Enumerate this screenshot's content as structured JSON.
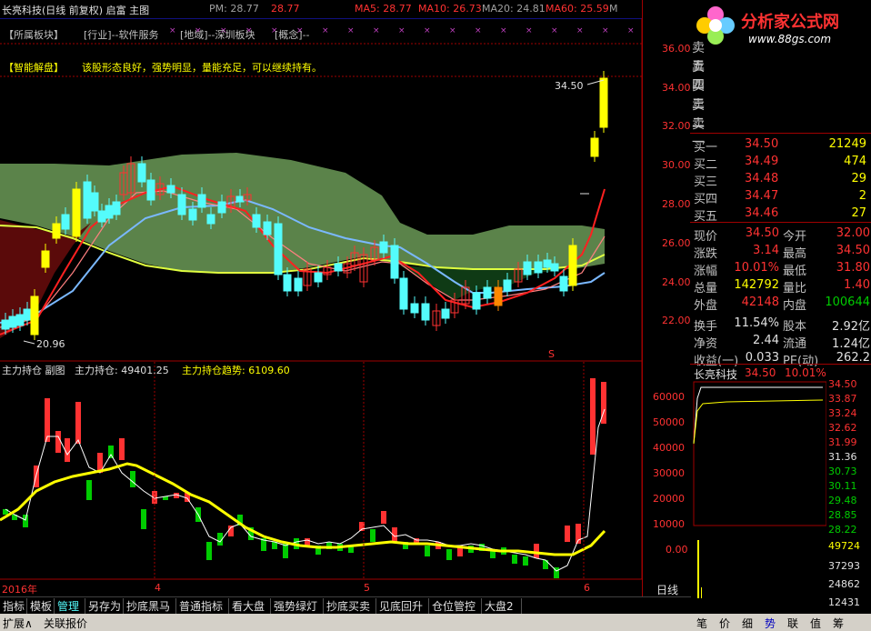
{
  "header": {
    "title": "长亮科技(日线 前复权) 启富 主图",
    "pm_label": "PM: 28.77",
    "last": "28.77",
    "ma5": "MA5: 28.77",
    "ma10": "MA10: 26.73",
    "ma20": "MA20: 24.81",
    "ma60": "MA60: 25.59",
    "m_trunc": "M"
  },
  "sectors": {
    "belong": "【所属板块】",
    "industry": "[行业]--软件服务",
    "region": "[地域]--深圳板块",
    "concept": "[概念]--"
  },
  "analysis": {
    "label": "【智能解盘】",
    "text": "该股形态良好，强势明显，量能充足，可以继续持有。"
  },
  "price_axis": [
    "36.00",
    "34.00",
    "32.00",
    "30.00",
    "28.00",
    "26.00",
    "24.00",
    "22.00"
  ],
  "annotations": {
    "high_price": "34.50",
    "low_price": "20.96",
    "s_mark": "S"
  },
  "sub_chart": {
    "title": "主力持仓 副图",
    "holding_label": "主力持仓: 49401.25",
    "trend_label": "主力持仓趋势: 6109.60",
    "axis": [
      "60000",
      "50000",
      "40000",
      "30000",
      "20000",
      "10000",
      "0.00"
    ]
  },
  "x_axis": {
    "labels": [
      "2016年",
      "4",
      "5",
      "6"
    ],
    "mode": "日线"
  },
  "order_book": {
    "asks": [
      {
        "label": "卖五",
        "price": "",
        "vol": ""
      },
      {
        "label": "卖四",
        "price": "",
        "vol": ""
      },
      {
        "label": "卖三",
        "price": "",
        "vol": ""
      },
      {
        "label": "卖二",
        "price": "",
        "vol": ""
      },
      {
        "label": "卖一",
        "price": "",
        "vol": ""
      }
    ],
    "bids": [
      {
        "label": "买一",
        "price": "34.50",
        "vol": "21249"
      },
      {
        "label": "买二",
        "price": "34.49",
        "vol": "474"
      },
      {
        "label": "买三",
        "price": "34.48",
        "vol": "29"
      },
      {
        "label": "买四",
        "price": "34.47",
        "vol": "2"
      },
      {
        "label": "买五",
        "price": "34.46",
        "vol": "27"
      }
    ]
  },
  "quote": {
    "now_l": "现价",
    "now_v": "34.50",
    "open_l": "今开",
    "open_v": "32.00",
    "chg_l": "涨跌",
    "chg_v": "3.14",
    "high_l": "最高",
    "high_v": "34.50",
    "pct_l": "涨幅",
    "pct_v": "10.01%",
    "low_l": "最低",
    "low_v": "31.80",
    "vol_l": "总量",
    "vol_v": "142792",
    "ratio_l": "量比",
    "ratio_v": "1.40",
    "out_l": "外盘",
    "out_v": "42148",
    "in_l": "内盘",
    "in_v": "100644",
    "turn_l": "换手",
    "turn_v": "11.54%",
    "cap_l": "股本",
    "cap_v": "2.92亿",
    "nav_l": "净资",
    "nav_v": "2.44",
    "float_l": "流通",
    "float_v": "1.24亿",
    "eps_l": "收益(一)",
    "eps_v": "0.033",
    "pe_l": "PE(动)",
    "pe_v": "262.2"
  },
  "intraday": {
    "name": "长亮科技",
    "price": "34.50",
    "pct": "10.01%",
    "price_axis": [
      "34.50",
      "33.87",
      "33.24",
      "32.62",
      "31.99",
      "31.36",
      "30.73",
      "30.11",
      "29.48",
      "28.85",
      "28.22"
    ],
    "vol_axis": [
      "49724",
      "37293",
      "24862",
      "12431"
    ]
  },
  "logo": {
    "text": "分析家公式网",
    "url": "www.88gs.com"
  },
  "bottom_tabs": [
    "指标",
    "模板",
    "管理",
    "另存为",
    "抄底黑马",
    "普通指标",
    "看大盘",
    "强势绿灯",
    "抄底买卖",
    "见底回升",
    "仓位管控",
    "大盘2"
  ],
  "status_bar": {
    "expand": "扩展∧",
    "report": "关联报价"
  },
  "right_tabs": [
    "笔",
    "价",
    "细",
    "势",
    "联",
    "值",
    "筹"
  ],
  "colors": {
    "up": "#ff3232",
    "down": "#54fcfc",
    "yellow": "#ffff00",
    "green": "#00cc00",
    "white": "#ffffff",
    "grid": "#a00000"
  }
}
